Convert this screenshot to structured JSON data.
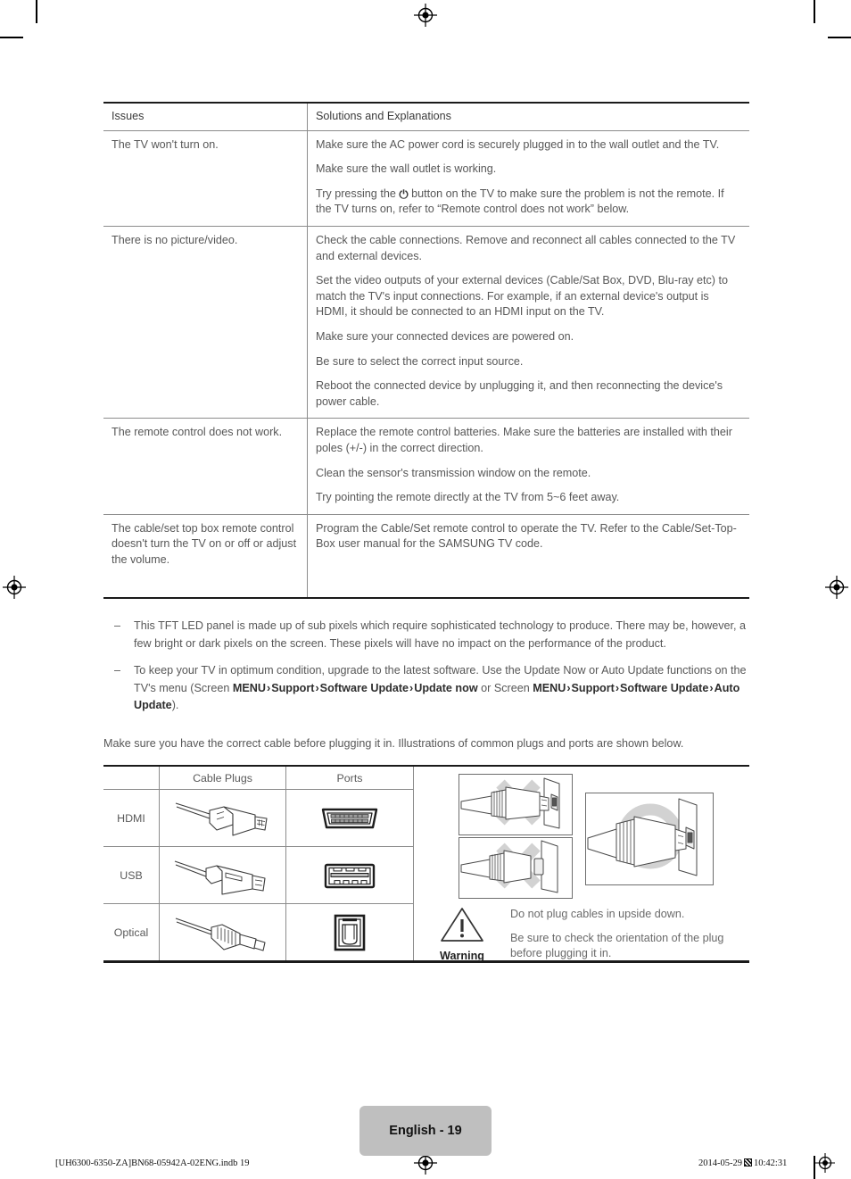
{
  "document": {
    "page_label": "English - 19",
    "footer_left": "[UH6300-6350-ZA]BN68-05942A-02ENG.indb   19",
    "footer_date": "2014-05-29",
    "footer_time": "10:42:31"
  },
  "troubleshooting": {
    "headers": {
      "issues": "Issues",
      "solutions": "Solutions and Explanations"
    },
    "rows": [
      {
        "issue": "The TV won't turn on.",
        "solutions": [
          "Make sure the AC power cord is securely plugged in to the wall outlet and the TV.",
          "Make sure the wall outlet is working.",
          "Try pressing the ⏻ button on the TV to make sure the problem is not the remote. If the TV turns on, refer to “Remote control does not work” below."
        ],
        "solutions_pre": [
          "",
          "",
          "Try pressing the "
        ],
        "solutions_post": [
          "",
          "",
          " button on the TV to make sure the problem is not the remote. If the TV turns on, refer to “Remote control does not work” below."
        ]
      },
      {
        "issue": "There is no picture/video.",
        "solutions": [
          "Check the cable connections. Remove and reconnect all cables connected to the TV and external devices.",
          "Set the video outputs of your external devices (Cable/Sat Box, DVD, Blu-ray etc) to match the TV's input connections. For example, if an external device's output is HDMI, it should be connected to an HDMI input on the TV.",
          "Make sure your connected devices are powered on.",
          "Be sure to select the correct input source.",
          "Reboot the connected device by unplugging it, and then reconnecting the device's power cable."
        ]
      },
      {
        "issue": "The remote control does not work.",
        "solutions": [
          "Replace the remote control batteries. Make sure the batteries are installed with their poles (+/-) in the correct direction.",
          "Clean the sensor's transmission window on the remote.",
          "Try pointing the remote directly at the TV from 5~6 feet away."
        ]
      },
      {
        "issue": "The cable/set top box remote control doesn't turn the TV on or off or adjust the volume.",
        "solutions": [
          "Program the Cable/Set remote control to operate the TV. Refer to the Cable/Set-Top-Box user manual for the SAMSUNG TV code."
        ]
      }
    ]
  },
  "notes": {
    "dash": "–",
    "items": [
      {
        "text": "This TFT LED panel is made up of sub pixels which require sophisticated technology to produce. There may be, however, a few bright or dark pixels on the screen. These pixels will have no impact on the performance of the product."
      },
      {
        "part1": "To keep your TV in optimum condition, upgrade to the latest software. Use the Update Now or Auto Update functions on the TV's menu (Screen ",
        "menu1": "MENU",
        "menu2": "Support",
        "menu3": "Software Update",
        "menu4": "Update now",
        "mid": " or Screen ",
        "menu5": "MENU",
        "menu6": "Support",
        "menu7": "Software Update",
        "menu8": "Auto Update",
        "part2": ").",
        "sep": "›"
      }
    ],
    "lead_line": "Make sure you have the correct cable before plugging it in. Illustrations of common plugs and ports are shown below."
  },
  "cable_table": {
    "headers": {
      "corner": "",
      "plugs": "Cable Plugs",
      "ports": "Ports"
    },
    "rows": [
      {
        "label": "HDMI",
        "plug_icon": "hdmi-plug-icon",
        "port_icon": "hdmi-port-icon"
      },
      {
        "label": "USB",
        "plug_icon": "usb-plug-icon",
        "port_icon": "usb-port-icon"
      },
      {
        "label": "Optical",
        "plug_icon": "optical-plug-icon",
        "port_icon": "optical-port-icon"
      }
    ]
  },
  "warning": {
    "label": "Warning",
    "icon": "warning-triangle-icon",
    "lines": [
      "Do not plug cables in upside down.",
      "Be sure to check the orientation of the plug before plugging it in."
    ],
    "illustrations": [
      {
        "name": "wrong-orientation-1",
        "mark": "cross"
      },
      {
        "name": "wrong-orientation-2",
        "mark": "cross"
      },
      {
        "name": "correct-orientation",
        "mark": "circle"
      }
    ]
  },
  "colors": {
    "rule_dark": "#1a1a1a",
    "rule_light": "#8c8c8c",
    "body_text": "#575757",
    "page_tab_bg": "#bfbfbf"
  }
}
